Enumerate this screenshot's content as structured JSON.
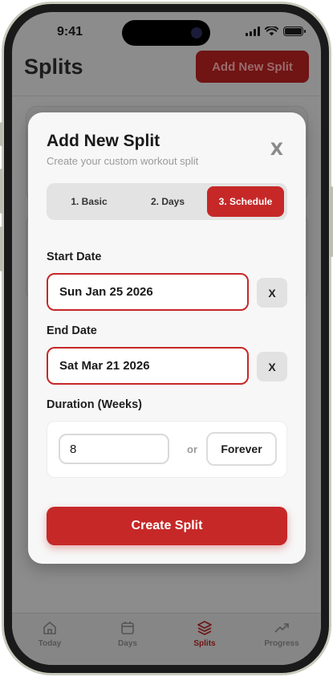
{
  "status_bar": {
    "time": "9:41"
  },
  "app": {
    "title": "Splits",
    "add_button_label": "Add New Split",
    "accent_color": "#c62828"
  },
  "tabbar": {
    "tabs": [
      {
        "label": "Today",
        "icon": "home-icon",
        "active": false
      },
      {
        "label": "Days",
        "icon": "calendar-icon",
        "active": false
      },
      {
        "label": "Splits",
        "icon": "layers-icon",
        "active": true
      },
      {
        "label": "Progress",
        "icon": "trend-icon",
        "active": false
      }
    ]
  },
  "modal": {
    "title": "Add New Split",
    "subtitle": "Create your custom workout split",
    "close_label": "X",
    "steps": [
      {
        "label": "1. Basic",
        "active": false
      },
      {
        "label": "2. Days",
        "active": false
      },
      {
        "label": "3. Schedule",
        "active": true
      }
    ],
    "start_date": {
      "label": "Start Date",
      "value": "Sun Jan 25 2026",
      "clear_label": "X"
    },
    "end_date": {
      "label": "End Date",
      "value": "Sat Mar 21 2026",
      "clear_label": "X"
    },
    "duration": {
      "label": "Duration (Weeks)",
      "value": "8",
      "or_text": "or",
      "forever_label": "Forever"
    },
    "create_label": "Create Split"
  }
}
